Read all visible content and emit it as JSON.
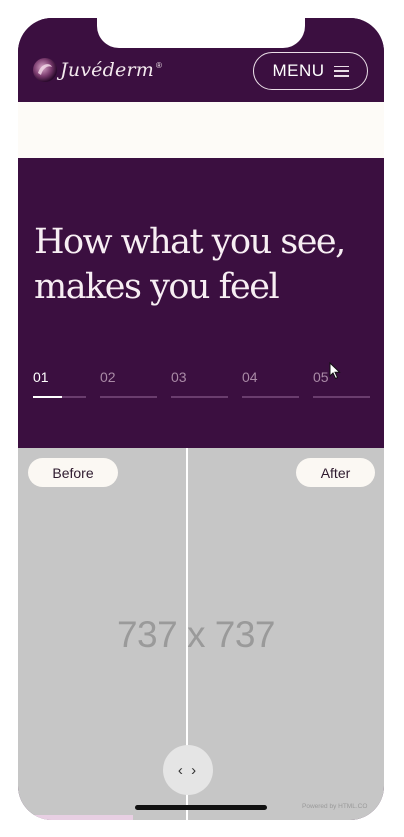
{
  "header": {
    "logo_text": "Juvéderm",
    "logo_reg": "®",
    "menu_label": "MENU"
  },
  "hero": {
    "title_line1": "How what you see,",
    "title_line2": "makes you feel"
  },
  "steps": {
    "items": [
      "01",
      "02",
      "03",
      "04",
      "05"
    ],
    "active_index": 0,
    "active_progress": 0.55
  },
  "compare": {
    "before_label": "Before",
    "after_label": "After",
    "placeholder": "737 x 737",
    "handle_glyph": "‹ ›",
    "powered_by": "Powered by HTML.CO"
  },
  "colors": {
    "brand_plum": "#3b0f40",
    "cream": "#fdfbf7",
    "placeholder_gray": "#c6c6c6"
  },
  "icons": [
    "juvederm-logo-icon",
    "hamburger-icon",
    "slider-arrows-icon",
    "mouse-cursor-icon"
  ]
}
